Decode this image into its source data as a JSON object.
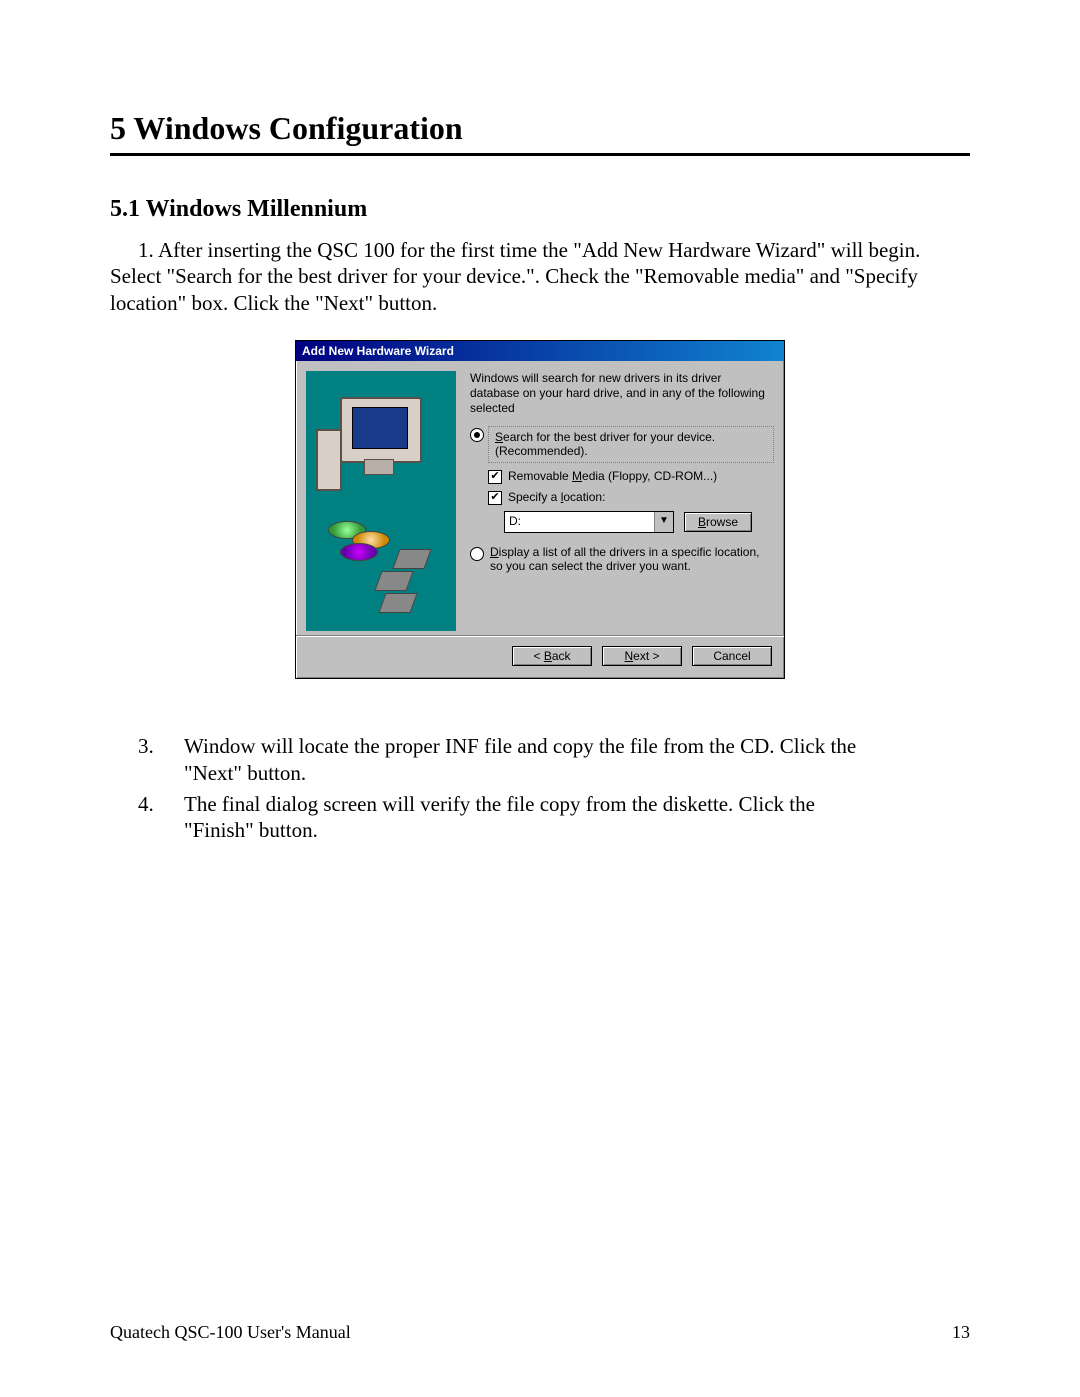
{
  "chapter": {
    "title": "5  Windows Configuration"
  },
  "section": {
    "title": "5.1   Windows Millennium"
  },
  "step1": {
    "num": "1.",
    "text": "After inserting the QSC 100 for the first time the \"Add New Hardware Wizard\" will begin.  Select \"Search for the best driver for your device.\". Check the \"Removable media\" and \"Specify location\" box. Click the \"Next\" button."
  },
  "dialog": {
    "title": "Add New Hardware Wizard",
    "intro": "Windows will search for new drivers in its driver database on your hard drive, and in any of the following selected",
    "radio_search_prefix": "S",
    "radio_search_rest": "earch for the best driver for your device. (Recommended).",
    "cb_removable_prefix": "Removable ",
    "cb_removable_u": "M",
    "cb_removable_rest": "edia (Floppy, CD-ROM...)",
    "cb_specify": "Specify a ",
    "cb_specify_u": "l",
    "cb_specify_rest": "ocation:",
    "path": "D:",
    "browse_u": "B",
    "browse_rest": "rowse",
    "radio_display_u": "D",
    "radio_display_rest": "isplay a list of all the drivers in a specific location, so you can select the driver you want.",
    "back": "< ",
    "back_u": "B",
    "back_rest": "ack",
    "next": "N",
    "next_rest": "ext >",
    "cancel": "Cancel"
  },
  "step3": {
    "num": "3.",
    "text": "Window will locate the proper INF file and copy the file from the CD. Click the \"Next\" button."
  },
  "step4": {
    "num": "4.",
    "text": "The final dialog screen will verify the file copy from the diskette. Click the \"Finish\" button."
  },
  "footer": {
    "left": "Quatech  QSC-100 User's Manual",
    "right": "13"
  }
}
